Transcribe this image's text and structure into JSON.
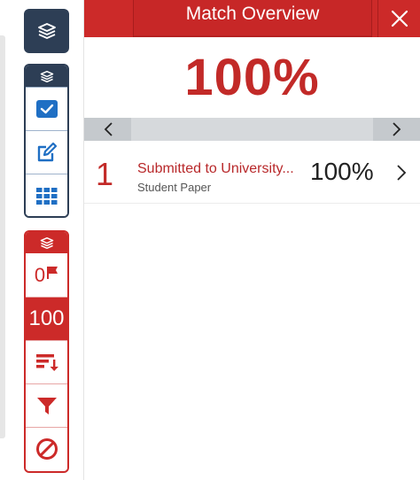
{
  "header": {
    "title": "Match Overview"
  },
  "overall": {
    "percent": "100%"
  },
  "tools": {
    "flags": {
      "count": "0"
    },
    "score": {
      "value": "100"
    }
  },
  "matches": [
    {
      "rank": "1",
      "source": "Submitted to University...",
      "type": "Student Paper",
      "percent": "100%"
    }
  ],
  "colors": {
    "accent_red": "#cc2a29",
    "navy": "#2d3e55",
    "pager_gray": "#d6d9dc"
  },
  "icons": [
    "layers-icon",
    "check-icon",
    "edit-icon",
    "grid-icon",
    "flag-icon",
    "sort-icon",
    "filter-icon",
    "ban-icon",
    "close-icon",
    "chevron-left-icon",
    "chevron-right-icon"
  ]
}
